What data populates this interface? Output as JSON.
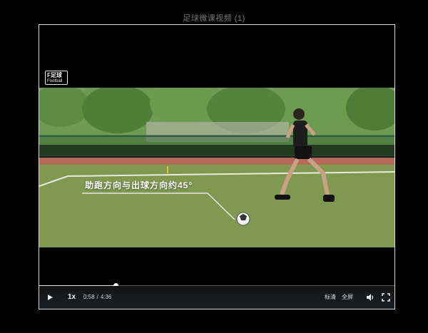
{
  "window": {
    "title": "足球微课视频 (1)"
  },
  "player": {
    "logo_line1": "F足球",
    "logo_line2": "Football",
    "caption": "助跑方向与出球方向约45°",
    "progress_fraction": 0.2149,
    "controls": {
      "speed_label": "1x",
      "current_time": "0:58",
      "separator": "/",
      "duration": "4:36",
      "quality_label": "标清",
      "fullscreen_text_label": "全屏",
      "play_icon": "play-icon",
      "volume_icon": "volume-icon",
      "fullscreen_icon": "fullscreen-icon"
    }
  },
  "colors": {
    "background": "#000000",
    "player_border": "#d9d9d9",
    "controls_bg": "#1b1f24",
    "pitch_green": "#7f9a50",
    "track_red": "#b56a5a"
  }
}
